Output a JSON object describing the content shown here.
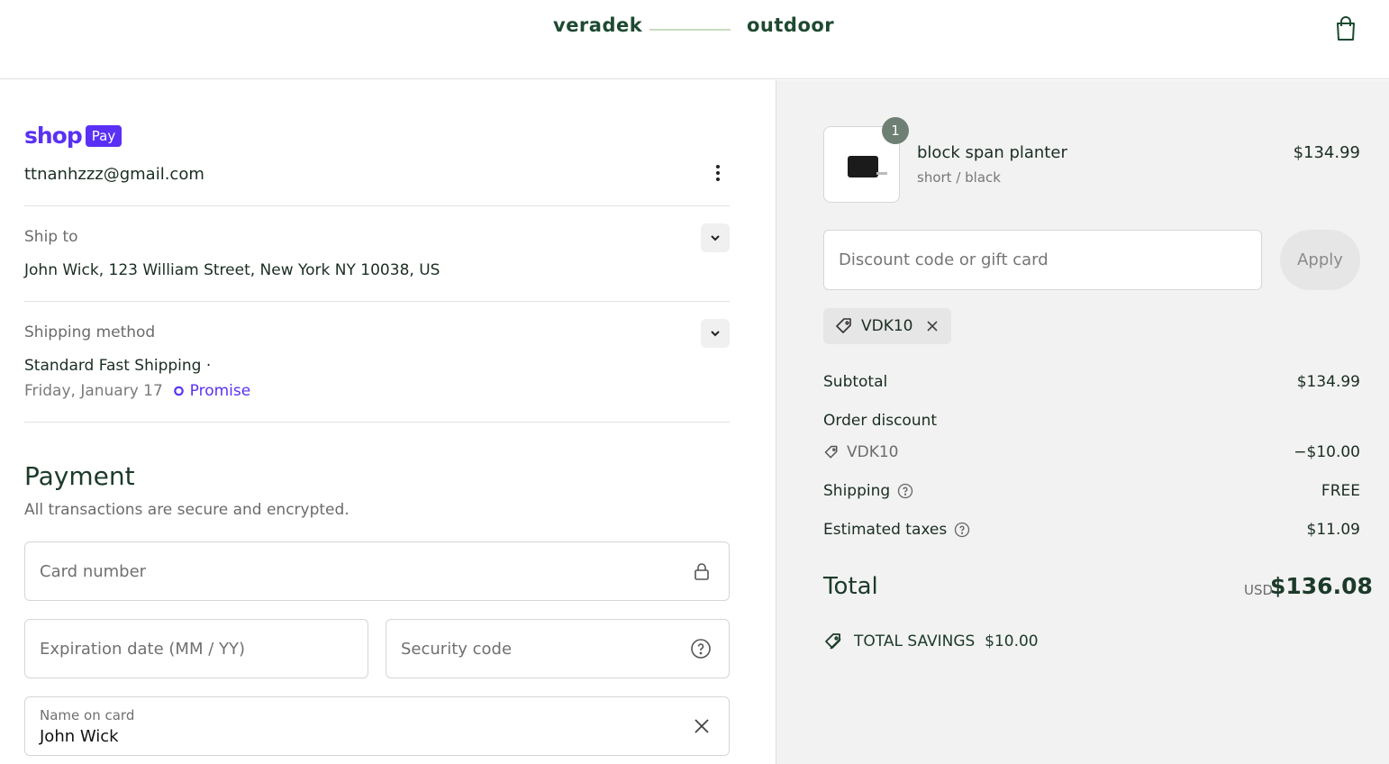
{
  "header": {
    "brand_left": "veradek",
    "brand_right": "outdoor",
    "cart_icon": "shopping-bag-icon"
  },
  "contact": {
    "shop_word": "shop",
    "pay_badge": "Pay",
    "email": "ttnanhzzz@gmail.com"
  },
  "ship_to": {
    "label": "Ship to",
    "value": "John Wick, 123 William Street, New York NY 10038, US"
  },
  "shipping_method": {
    "label": "Shipping method",
    "name": "Standard Fast Shipping ·",
    "date": "Friday, January 17",
    "promise": "Promise"
  },
  "payment": {
    "title": "Payment",
    "subtitle": "All transactions are secure and encrypted.",
    "card_number_placeholder": "Card number",
    "expiration_placeholder": "Expiration date (MM / YY)",
    "security_placeholder": "Security code",
    "name_label": "Name on card",
    "name_value": "John Wick"
  },
  "cart": {
    "quantity": "1",
    "product_name": "block span planter",
    "variant": "short / black",
    "price": "$134.99"
  },
  "discount": {
    "placeholder": "Discount code or gift card",
    "apply_label": "Apply",
    "applied_code": "VDK10"
  },
  "summary": {
    "subtotal_label": "Subtotal",
    "subtotal_value": "$134.99",
    "order_discount_label": "Order discount",
    "discount_code": "VDK10",
    "discount_value": "−$10.00",
    "shipping_label": "Shipping",
    "shipping_value": "FREE",
    "taxes_label": "Estimated taxes",
    "taxes_value": "$11.09",
    "total_label": "Total",
    "currency": "USD",
    "total_value": "$136.08",
    "savings_label": "TOTAL SAVINGS",
    "savings_value": "$10.00"
  },
  "colors": {
    "brand_green": "#1e4a30",
    "shop_purple": "#5a31f4",
    "sidebar_bg": "#f2f2f2"
  }
}
